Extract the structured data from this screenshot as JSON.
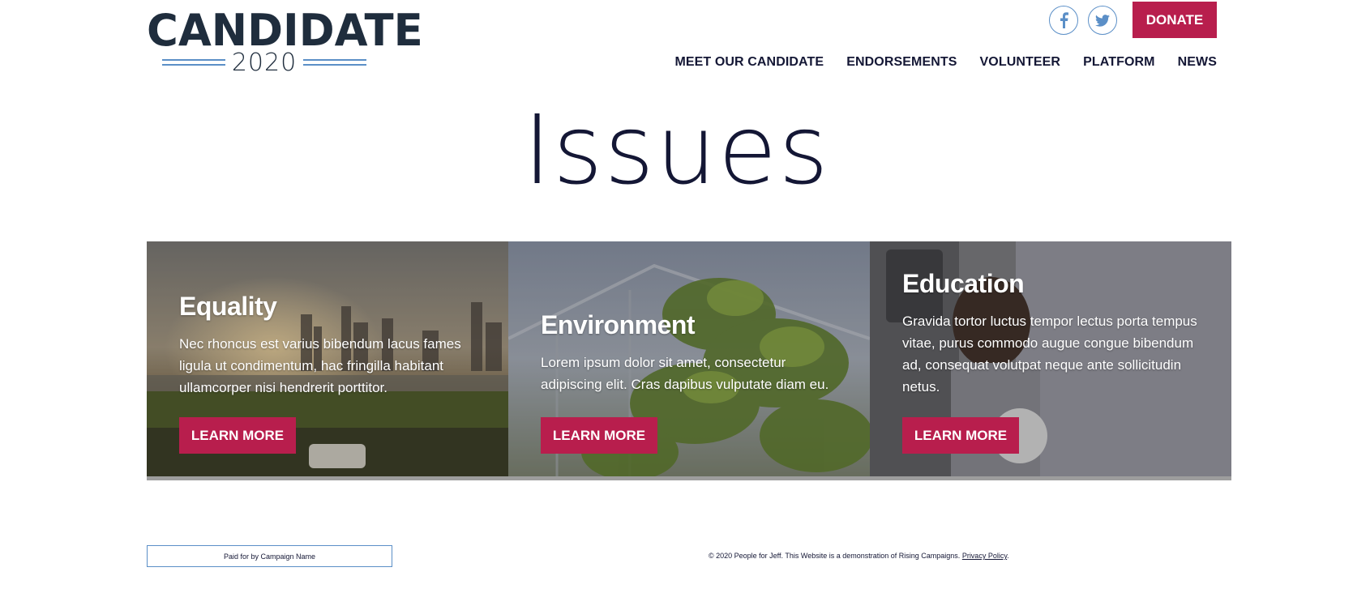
{
  "header": {
    "logo_main": "CANDIDATE",
    "logo_year": "2020",
    "social": [
      {
        "icon": "facebook-icon"
      },
      {
        "icon": "twitter-icon"
      }
    ],
    "donate_label": "DONATE",
    "nav": [
      {
        "label": "MEET OUR CANDIDATE"
      },
      {
        "label": "ENDORSEMENTS"
      },
      {
        "label": "VOLUNTEER"
      },
      {
        "label": "PLATFORM"
      },
      {
        "label": "NEWS"
      }
    ]
  },
  "main": {
    "title": "Issues",
    "cards": [
      {
        "title": "Equality",
        "text": "Nec rhoncus est varius bibendum lacus fames ligula ut condimentum, hac fringilla habitant ullamcorper nisi hendrerit porttitor.",
        "button": "LEARN MORE"
      },
      {
        "title": "Environment",
        "text": "Lorem ipsum dolor sit amet, consectetur adipiscing elit. Cras dapibus vulputate diam eu.",
        "button": "LEARN MORE"
      },
      {
        "title": "Education",
        "text": "Gravida tortor luctus tempor lectus porta tempus vitae, purus commodo augue congue bibendum ad, consequat volutpat neque ante sollicitudin netus.",
        "button": "LEARN MORE"
      }
    ]
  },
  "footer": {
    "paid_for": "Paid for by Campaign Name",
    "copyright": "© 2020 People for Jeff. This Website is a demonstration of Rising Campaigns.",
    "privacy_link": "Privacy Policy",
    "period": "."
  },
  "colors": {
    "accent": "#b81e4d",
    "navy": "#141735",
    "logo_blue": "#5b8fc7"
  }
}
